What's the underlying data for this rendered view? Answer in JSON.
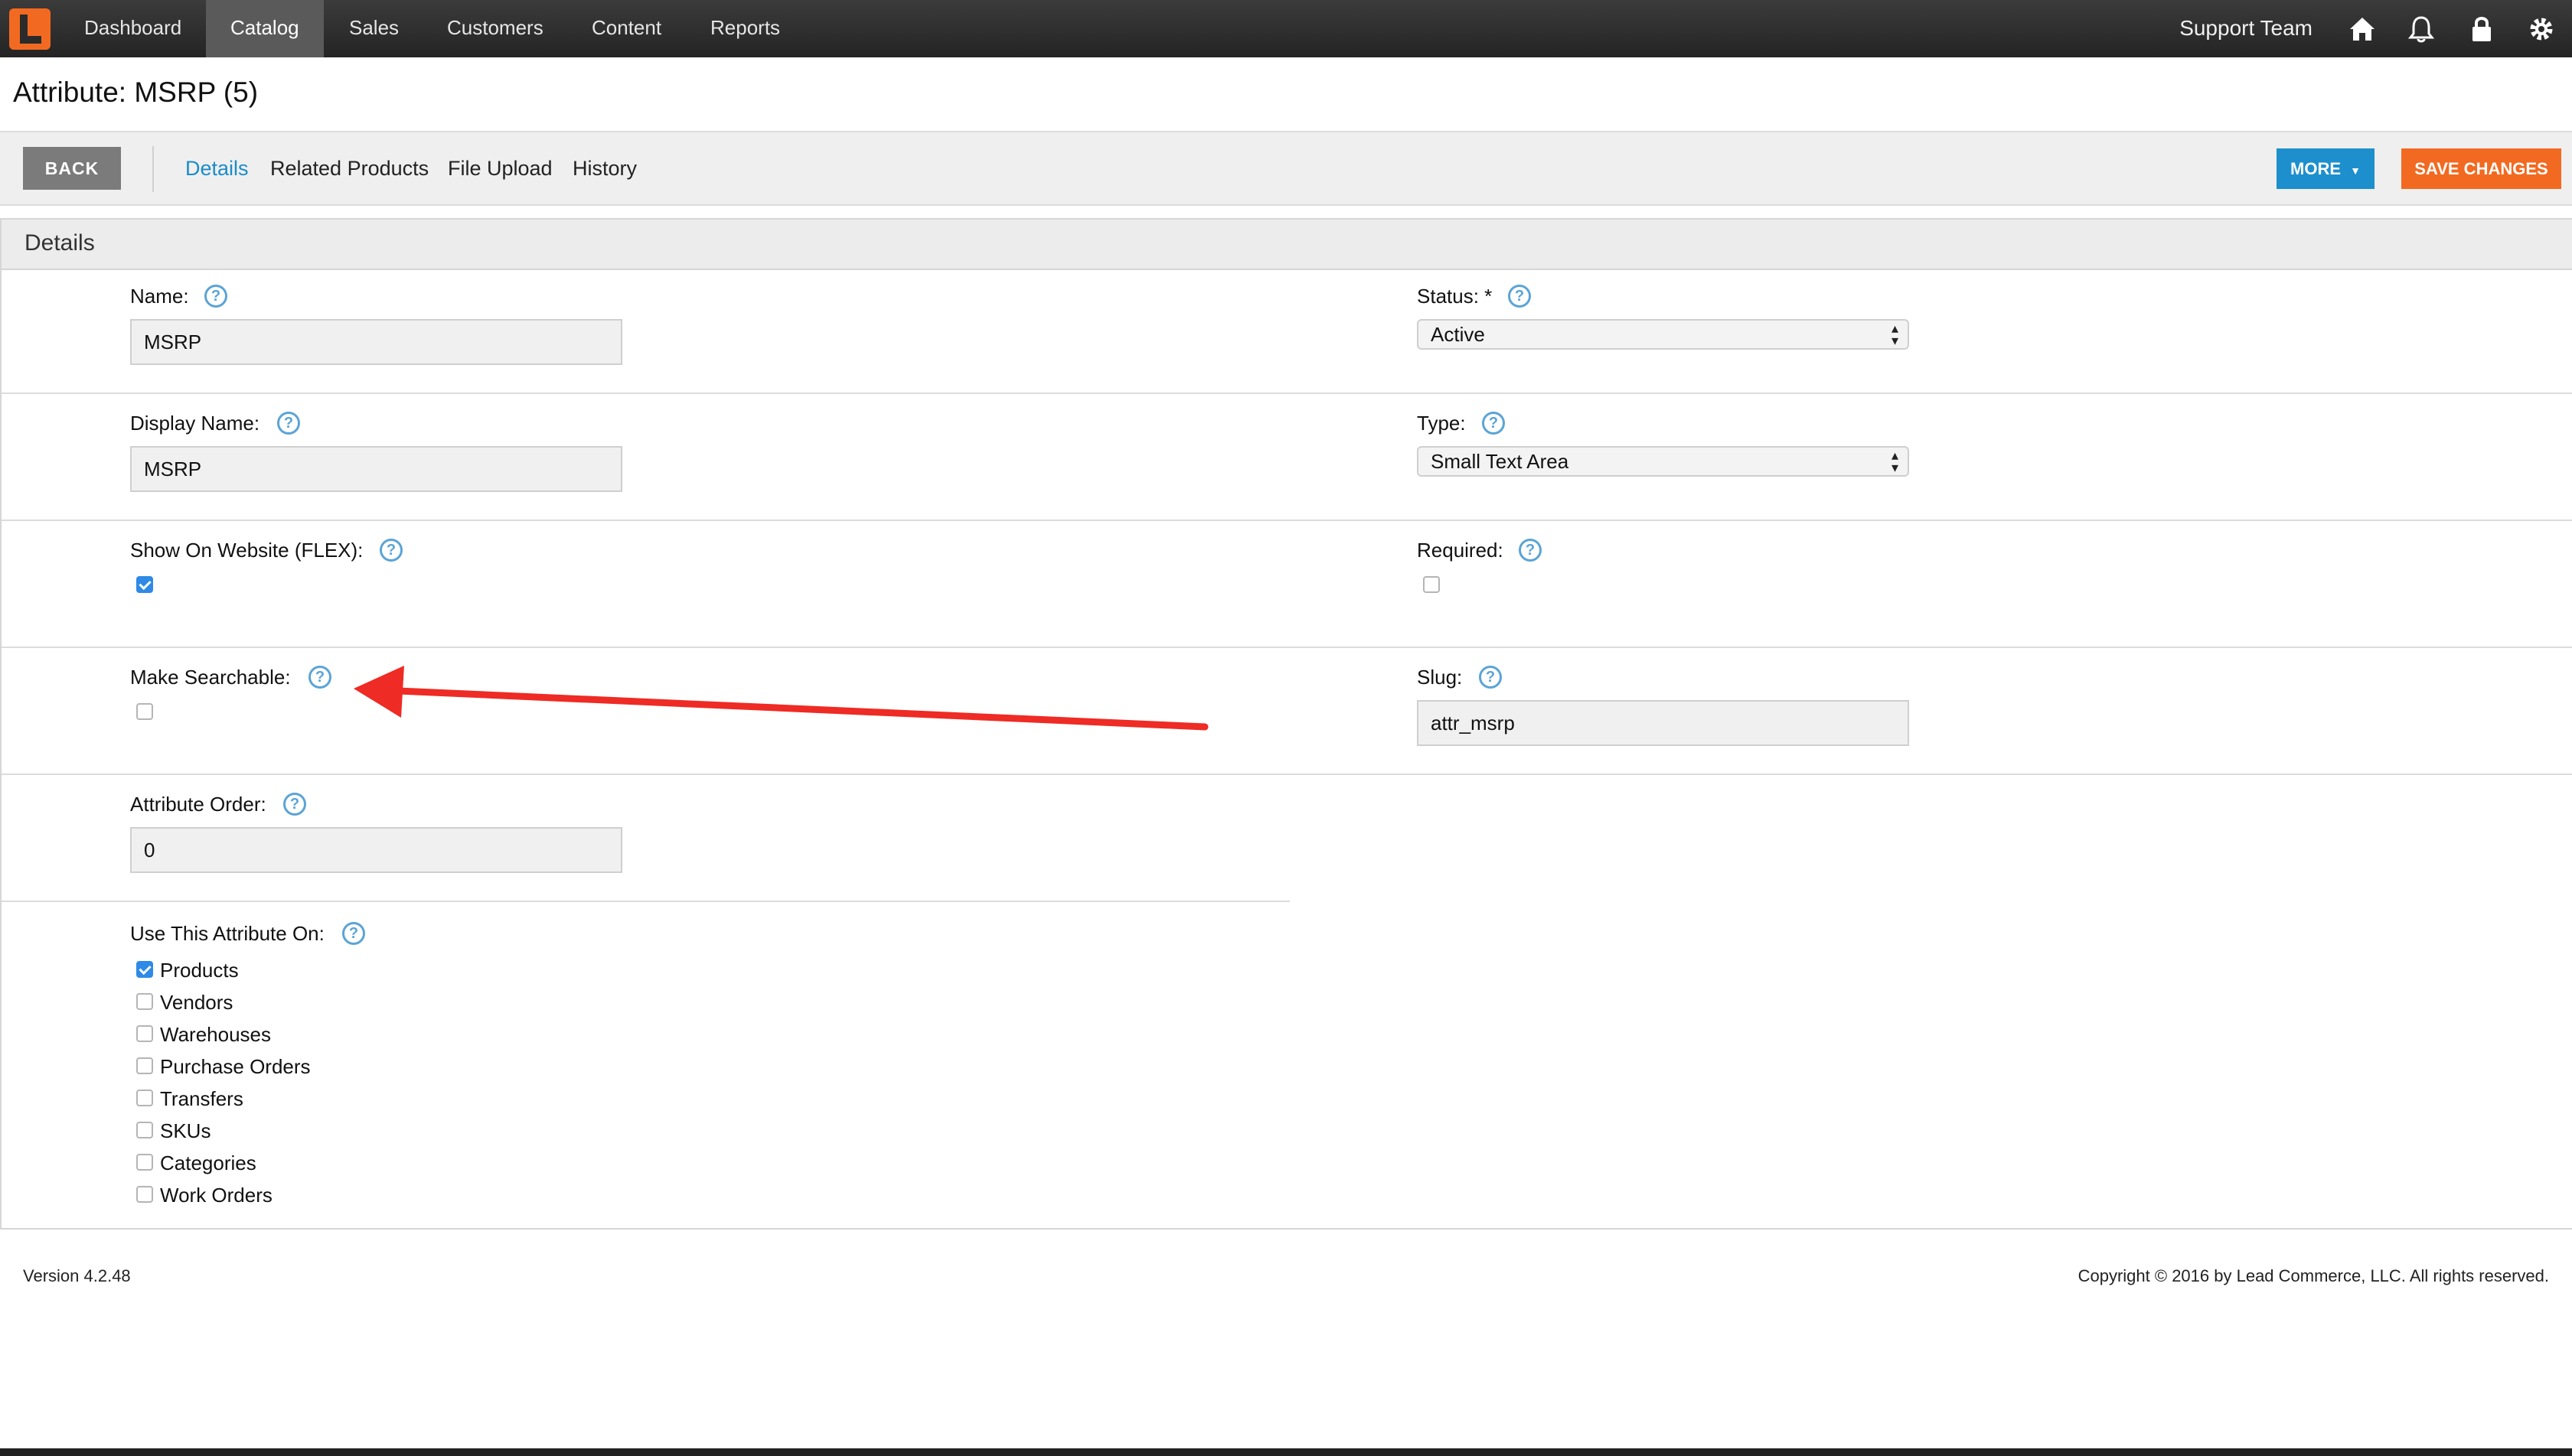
{
  "nav": {
    "items": [
      "Dashboard",
      "Catalog",
      "Sales",
      "Customers",
      "Content",
      "Reports"
    ],
    "active": "Catalog",
    "user": "Support Team",
    "icons": [
      "home-icon",
      "bell-icon",
      "lock-icon",
      "gear-icon"
    ]
  },
  "page": {
    "title": "Attribute: MSRP (5)"
  },
  "toolbar": {
    "back_label": "BACK",
    "tabs": [
      "Details",
      "Related Products",
      "File Upload",
      "History"
    ],
    "active_tab": "Details",
    "more_label": "MORE",
    "save_label": "SAVE CHANGES"
  },
  "panel": {
    "title": "Details"
  },
  "fields": {
    "name": {
      "label": "Name:",
      "value": "MSRP"
    },
    "status": {
      "label": "Status: *",
      "value": "Active"
    },
    "display_name": {
      "label": "Display Name:",
      "value": "MSRP"
    },
    "type": {
      "label": "Type:",
      "value": "Small Text Area"
    },
    "show_on_website": {
      "label": "Show On Website (FLEX):",
      "checked": true
    },
    "required": {
      "label": "Required:",
      "checked": false
    },
    "make_searchable": {
      "label": "Make Searchable:",
      "checked": false
    },
    "slug": {
      "label": "Slug:",
      "value": "attr_msrp"
    },
    "attribute_order": {
      "label": "Attribute Order:",
      "value": "0"
    },
    "use_on": {
      "label": "Use This Attribute On:",
      "options": [
        {
          "label": "Products",
          "checked": true
        },
        {
          "label": "Vendors",
          "checked": false
        },
        {
          "label": "Warehouses",
          "checked": false
        },
        {
          "label": "Purchase Orders",
          "checked": false
        },
        {
          "label": "Transfers",
          "checked": false
        },
        {
          "label": "SKUs",
          "checked": false
        },
        {
          "label": "Categories",
          "checked": false
        },
        {
          "label": "Work Orders",
          "checked": false
        }
      ]
    }
  },
  "footer": {
    "version": "Version 4.2.48",
    "copyright": "Copyright © 2016 by Lead Commerce, LLC. All rights reserved."
  },
  "colors": {
    "accent_blue": "#1d8fcd",
    "save_orange": "#f26a21",
    "annotation_red": "#ee2b24"
  }
}
